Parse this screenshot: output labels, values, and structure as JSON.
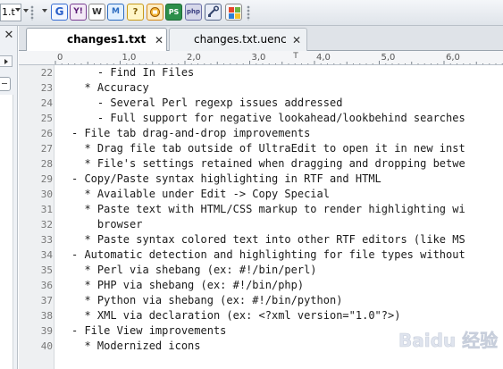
{
  "toolbar": {
    "combo_value": "1.t",
    "icons": [
      "google-search-icon",
      "yahoo-search-icon",
      "wikipedia-icon",
      "msn-icon",
      "help-icon",
      "dictionary-icon",
      "ps-icon",
      "php-icon",
      "tool-icon",
      "windows-icon"
    ],
    "g_label": "G",
    "y_label": "Y!",
    "w_label": "W",
    "msn_label": "M",
    "q_label": "?",
    "ps_label": "PS",
    "php_label": "php"
  },
  "tabs": [
    {
      "label": "changes1.txt",
      "active": true
    },
    {
      "label": "changes.txt.uenc",
      "active": false
    }
  ],
  "ruler": {
    "labels": [
      "0",
      "1,0",
      "2,0",
      "3,0",
      "4,0",
      "5,0",
      "6,0"
    ]
  },
  "editor": {
    "lines": [
      {
        "number": "22",
        "text": "    - Find In Files"
      },
      {
        "number": "23",
        "text": "  * Accuracy"
      },
      {
        "number": "24",
        "text": "    - Several Perl regexp issues addressed"
      },
      {
        "number": "25",
        "text": "    - Full support for negative lookahead/lookbehind searches"
      },
      {
        "number": "26",
        "text": "- File tab drag-and-drop improvements"
      },
      {
        "number": "27",
        "text": "  * Drag file tab outside of UltraEdit to open it in new inst"
      },
      {
        "number": "28",
        "text": "  * File's settings retained when dragging and dropping betwe"
      },
      {
        "number": "29",
        "text": "- Copy/Paste syntax highlighting in RTF and HTML"
      },
      {
        "number": "30",
        "text": "  * Available under Edit -> Copy Special"
      },
      {
        "number": "31",
        "text": "  * Paste text with HTML/CSS markup to render highlighting wi"
      },
      {
        "number": "32",
        "text": "    browser"
      },
      {
        "number": "33",
        "text": "  * Paste syntax colored text into other RTF editors (like MS"
      },
      {
        "number": "34",
        "text": "- Automatic detection and highlighting for file types without"
      },
      {
        "number": "35",
        "text": "  * Perl via shebang (ex: #!/bin/perl)"
      },
      {
        "number": "36",
        "text": "  * PHP via shebang (ex: #!/bin/php)"
      },
      {
        "number": "37",
        "text": "  * Python via shebang (ex: #!/bin/python)"
      },
      {
        "number": "38",
        "text": "  * XML via declaration (ex: <?xml version=\"1.0\"?>)"
      },
      {
        "number": "39",
        "text": "- File View improvements"
      },
      {
        "number": "40",
        "text": "  * Modernized icons"
      }
    ]
  },
  "watermark": {
    "text": "Baidu 经验"
  }
}
